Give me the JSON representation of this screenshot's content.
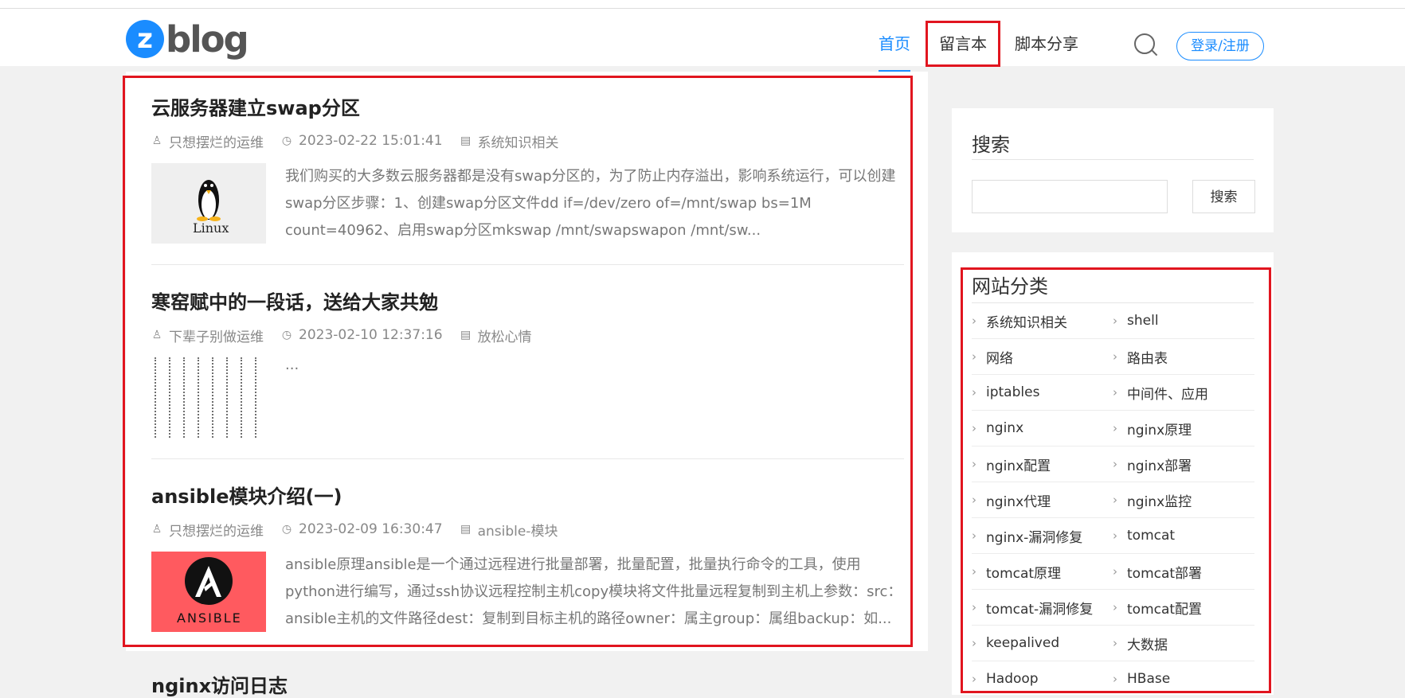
{
  "header": {
    "logo_text": "blog",
    "nav": [
      "首页",
      "留言本",
      "脚本分享"
    ],
    "login": "登录/注册"
  },
  "articles": [
    {
      "title": "云服务器建立swap分区",
      "author": "只想摆烂的运维",
      "date": "2023-02-22 15:01:41",
      "category": "系统知识相关",
      "thumbnail_label": "Linux",
      "excerpt": "我们购买的大多数云服务器都是没有swap分区的，为了防止内存溢出，影响系统运行，可以创建swap分区步骤：1、创建swap分区文件dd if=/dev/zero of=/mnt/swap bs=1M count=40962、启用swap分区mkswap /mnt/swapswapon /mnt/sw..."
    },
    {
      "title": "寒窑赋中的一段话，送给大家共勉",
      "author": "下辈子别做运维",
      "date": "2023-02-10 12:37:16",
      "category": "放松心情",
      "excerpt": "..."
    },
    {
      "title": "ansible模块介绍(一)",
      "author": "只想摆烂的运维",
      "date": "2023-02-09 16:30:47",
      "category": "ansible-模块",
      "thumbnail_label": "ANSIBLE",
      "excerpt": "ansible原理ansible是一个通过远程进行批量部署，批量配置，批量执行命令的工具，使用python进行编写，通过ssh协议远程控制主机copy模块将文件批量远程复制到主机上参数：src：ansible主机的文件路径dest：复制到目标主机的路径owner：属主group：属组backup：如..."
    },
    {
      "title": "nginx访问日志"
    }
  ],
  "sidebar": {
    "search_title": "搜索",
    "search_button": "搜索",
    "categories_title": "网站分类",
    "categories": [
      "系统知识相关",
      "shell",
      "网络",
      "路由表",
      "iptables",
      "中间件、应用",
      "nginx",
      "nginx原理",
      "nginx配置",
      "nginx部署",
      "nginx代理",
      "nginx监控",
      "nginx-漏洞修复",
      "tomcat",
      "tomcat原理",
      "tomcat部署",
      "tomcat-漏洞修复",
      "tomcat配置",
      "keepalived",
      "大数据",
      "Hadoop",
      "HBase"
    ]
  },
  "colors": {
    "accent": "#1a8cff",
    "highlight_border": "#e1151f",
    "ansible_bg": "#ff5a5f"
  }
}
